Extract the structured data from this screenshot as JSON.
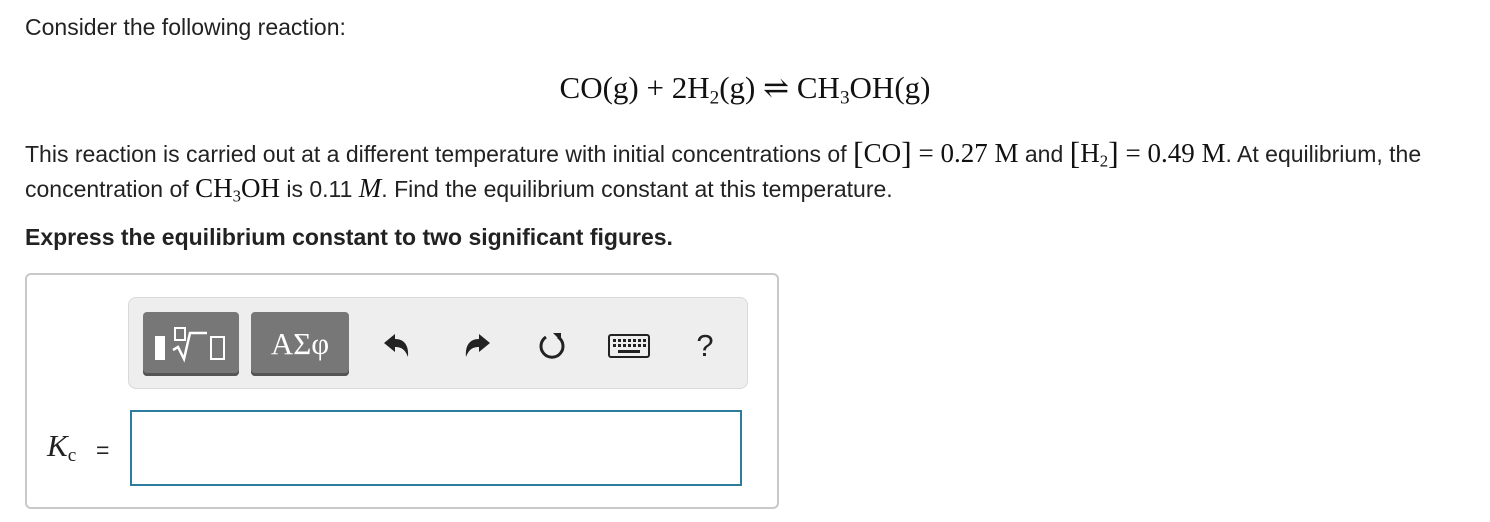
{
  "question": {
    "intro": "Consider the following reaction:",
    "equation": {
      "reactant1": "CO(g)",
      "plus": "+",
      "reactant2_coef_formula": "2H",
      "reactant2_sub": "2",
      "reactant2_state": "(g)",
      "arrow": "⇌",
      "product_formula": "CH",
      "product_sub": "3",
      "product_rest": "OH(g)"
    },
    "problem": {
      "part1": "This reaction is carried out at a different temperature with initial concentrations of ",
      "co_species": "CO",
      "co_value": " = 0.27 M",
      "and_text": " and ",
      "h2_species": "H",
      "h2_sub": "2",
      "h2_value": " = 0.49 M",
      "part2": ". At equilibrium, the concentration of ",
      "ch3oh_formula": "CH",
      "ch3oh_sub": "3",
      "ch3oh_rest": "OH",
      "part3": " is 0.11 ",
      "unit_m": "M",
      "part4": ". Find the equilibrium constant at this temperature."
    },
    "instruction": "Express the equilibrium constant to two significant figures."
  },
  "toolbar": {
    "templates_icon": "templates-sqrt-icon",
    "symbols_label": "ΑΣφ",
    "undo_icon": "undo-icon",
    "redo_icon": "redo-icon",
    "reset_icon": "reset-icon",
    "keyboard_icon": "keyboard-icon",
    "help_label": "?"
  },
  "answer": {
    "label_main": "K",
    "label_sub": "c",
    "equals": "=",
    "value": ""
  },
  "colors": {
    "input_border": "#2e7d9c",
    "tool_button": "#777777",
    "toolbar_bg": "#eeeeee"
  }
}
